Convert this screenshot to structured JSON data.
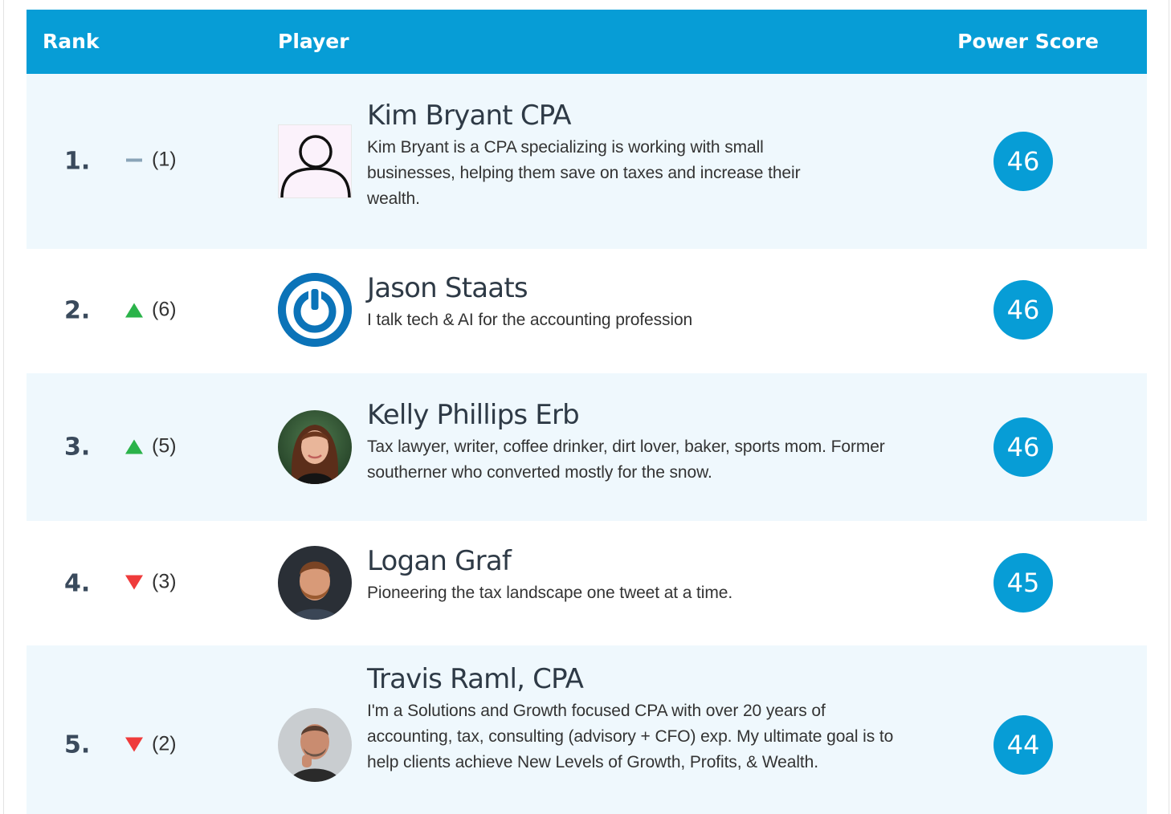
{
  "header": {
    "rank": "Rank",
    "player": "Player",
    "score": "Power Score"
  },
  "rows": [
    {
      "rank": "1.",
      "trend": "same",
      "change": "(1)",
      "name": "Kim Bryant CPA",
      "description": "Kim Bryant is a CPA specializing is working with small businesses, helping them save on taxes and increase their wealth.",
      "score": "46",
      "avatar": "default-user-icon"
    },
    {
      "rank": "2.",
      "trend": "up",
      "change": "(6)",
      "name": "Jason Staats",
      "description": "I talk tech & AI for the accounting profession",
      "score": "46",
      "avatar": "power-logo-icon"
    },
    {
      "rank": "3.",
      "trend": "up",
      "change": "(5)",
      "name": "Kelly Phillips Erb",
      "description": "Tax lawyer, writer, coffee drinker, dirt lover, baker, sports mom. Former southerner who converted mostly for the snow.",
      "score": "46",
      "avatar": "profile-photo"
    },
    {
      "rank": "4.",
      "trend": "down",
      "change": "(3)",
      "name": "Logan Graf",
      "description": "Pioneering the tax landscape one tweet at a time.",
      "score": "45",
      "avatar": "profile-photo"
    },
    {
      "rank": "5.",
      "trend": "down",
      "change": "(2)",
      "name": "Travis Raml, CPA",
      "description": "I'm a Solutions and Growth focused CPA with over 20 years of accounting, tax, consulting (advisory + CFO) exp. My ultimate goal is to help clients achieve New Levels of Growth, Profits, & Wealth.",
      "score": "44",
      "avatar": "profile-photo"
    }
  ],
  "colors": {
    "accent": "#079dd6",
    "row_alt": "#eff8fd",
    "trend_up": "#2bb34a",
    "trend_down": "#ef3b3b",
    "trend_same": "#8aa4b8"
  }
}
